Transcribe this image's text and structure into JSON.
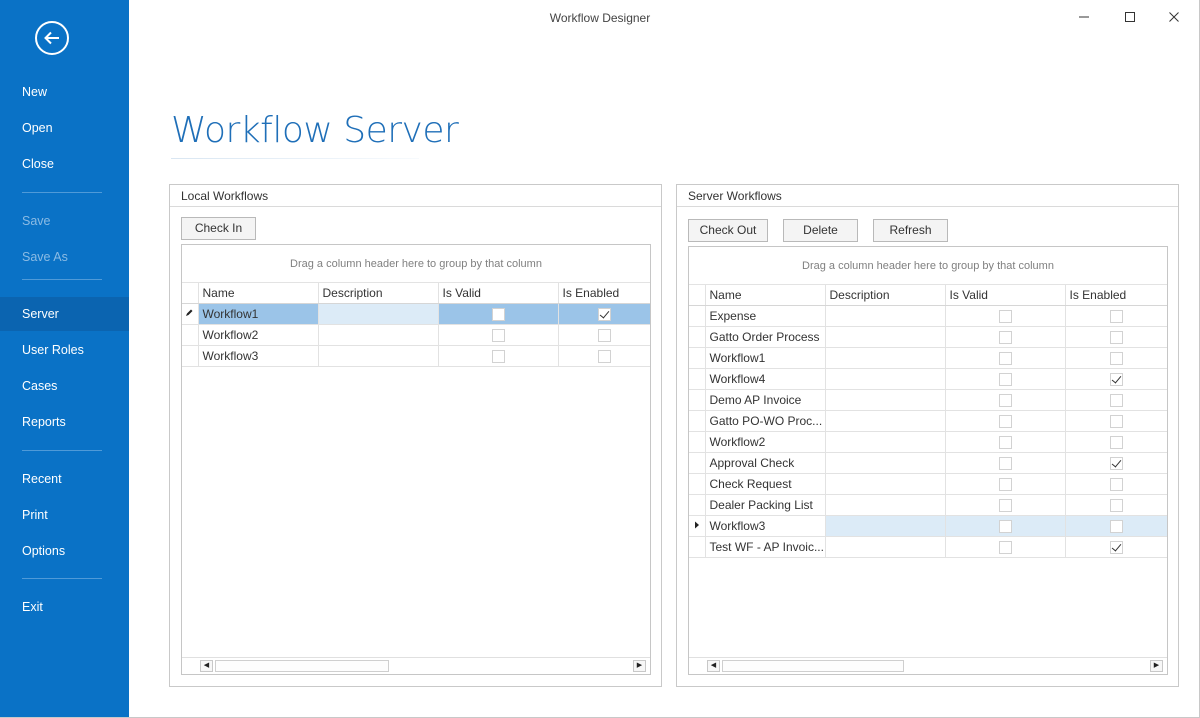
{
  "window": {
    "title": "Workflow Designer",
    "minimize_glyph": "—",
    "maximize_glyph": "☐",
    "close_glyph": "✕"
  },
  "sidebar": {
    "back_icon": "arrow-left-icon",
    "items": [
      {
        "label": "New",
        "enabled": true
      },
      {
        "label": "Open",
        "enabled": true
      },
      {
        "label": "Close",
        "enabled": true
      },
      {
        "label": "Save",
        "enabled": false
      },
      {
        "label": "Save As",
        "enabled": false
      },
      {
        "label": "Server",
        "enabled": true,
        "selected": true
      },
      {
        "label": "User Roles",
        "enabled": true
      },
      {
        "label": "Cases",
        "enabled": true
      },
      {
        "label": "Reports",
        "enabled": true
      },
      {
        "label": "Recent",
        "enabled": true
      },
      {
        "label": "Print",
        "enabled": true
      },
      {
        "label": "Options",
        "enabled": true
      },
      {
        "label": "Exit",
        "enabled": true
      }
    ]
  },
  "page": {
    "title": "Workflow Server"
  },
  "local": {
    "header": "Local Workflows",
    "buttons": {
      "check_in": "Check In"
    },
    "group_panel_text": "Drag a column header here to group by that column",
    "columns": [
      "Name",
      "Description",
      "Is Valid",
      "Is Enabled"
    ],
    "rows": [
      {
        "name": "Workflow1",
        "description": "",
        "is_valid": false,
        "is_enabled": true
      },
      {
        "name": "Workflow2",
        "description": "",
        "is_valid": false,
        "is_enabled": false
      },
      {
        "name": "Workflow3",
        "description": "",
        "is_valid": false,
        "is_enabled": false
      }
    ],
    "editing_row_index": 0
  },
  "server": {
    "header": "Server Workflows",
    "buttons": {
      "check_out": "Check Out",
      "delete": "Delete",
      "refresh": "Refresh"
    },
    "group_panel_text": "Drag a column header here to group by that column",
    "columns": [
      "Name",
      "Description",
      "Is Valid",
      "Is Enabled"
    ],
    "rows": [
      {
        "name": "Expense",
        "description": "",
        "is_valid": false,
        "is_enabled": false
      },
      {
        "name": "Gatto Order Process",
        "description": "",
        "is_valid": false,
        "is_enabled": false
      },
      {
        "name": "Workflow1",
        "description": "",
        "is_valid": false,
        "is_enabled": false
      },
      {
        "name": "Workflow4",
        "description": "",
        "is_valid": false,
        "is_enabled": true
      },
      {
        "name": "Demo AP Invoice",
        "description": "",
        "is_valid": false,
        "is_enabled": false
      },
      {
        "name": "Gatto PO-WO Proc...",
        "description": "",
        "is_valid": false,
        "is_enabled": false
      },
      {
        "name": "Workflow2",
        "description": "",
        "is_valid": false,
        "is_enabled": false
      },
      {
        "name": "Approval Check",
        "description": "",
        "is_valid": false,
        "is_enabled": true
      },
      {
        "name": "Check Request",
        "description": "",
        "is_valid": false,
        "is_enabled": false
      },
      {
        "name": "Dealer Packing List",
        "description": "",
        "is_valid": false,
        "is_enabled": false
      },
      {
        "name": "Workflow3",
        "description": "",
        "is_valid": false,
        "is_enabled": false
      },
      {
        "name": "Test WF - AP Invoic...",
        "description": "",
        "is_valid": false,
        "is_enabled": true
      }
    ],
    "current_row_index": 10
  },
  "scrollbar": {
    "left_glyph": "◀",
    "right_glyph": "▶"
  },
  "colors": {
    "sidebar": "#0a72c6",
    "accent": "#1f6fb8",
    "selection": "#9bc4e8"
  }
}
